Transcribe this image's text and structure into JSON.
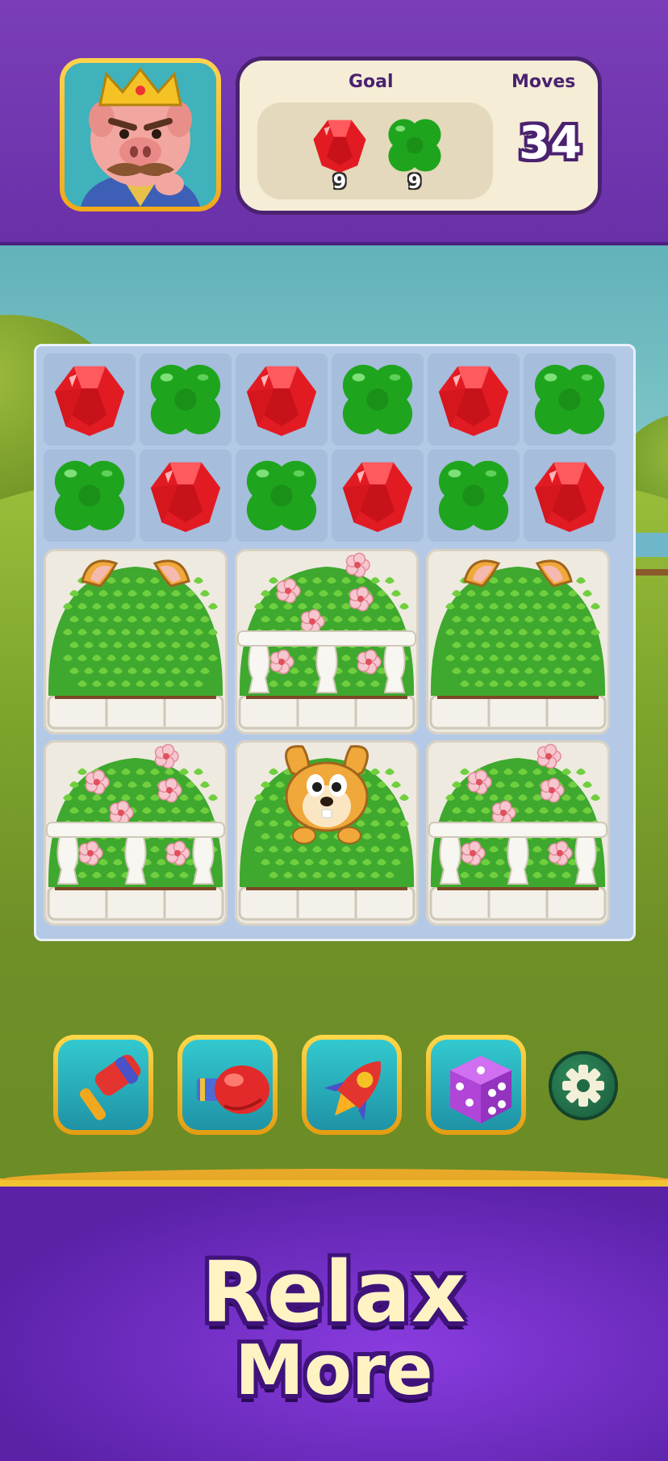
{
  "header": {
    "goal_label": "Goal",
    "moves_label": "Moves",
    "moves_value": "34",
    "avatar_icon": "king-pig-avatar-icon",
    "goals": [
      {
        "icon": "red-gem-icon",
        "count": "9",
        "color": "#e21b23"
      },
      {
        "icon": "green-clover-icon",
        "count": "9",
        "color": "#1fa51d"
      }
    ]
  },
  "board": {
    "rows": [
      [
        "gem",
        "clover",
        "gem",
        "clover",
        "gem",
        "clover"
      ],
      [
        "clover",
        "gem",
        "clover",
        "gem",
        "clover",
        "gem"
      ]
    ],
    "bush_tiles": [
      [
        "bush-with-hidden-rabbit-ears",
        "bush-with-flowers-and-railing",
        "bush-with-hidden-rabbit-ears"
      ],
      [
        "bush-with-flowers-and-railing",
        "bush-with-rabbit",
        "bush-with-flowers-and-railing"
      ]
    ]
  },
  "boosters": [
    {
      "icon": "hammer-icon"
    },
    {
      "icon": "boxing-glove-icon"
    },
    {
      "icon": "rocket-icon"
    },
    {
      "icon": "dice-icon"
    }
  ],
  "settings": {
    "icon": "gear-icon"
  },
  "footer": {
    "slogan_line_1": "Relax",
    "slogan_line_2": "More"
  },
  "colors": {
    "header_purple": "#6a30a8",
    "gem_red": "#e21b23",
    "clover_green": "#1fa51d",
    "frame_gold": "#f0a91a",
    "footer_purple": "#5b22a8"
  }
}
